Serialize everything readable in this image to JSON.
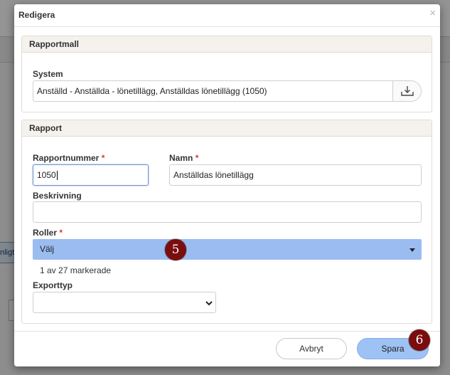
{
  "background": {
    "chip_text": "nligt"
  },
  "modal": {
    "title": "Redigera",
    "close_glyph": "×"
  },
  "panel_rapportmall": {
    "heading": "Rapportmall",
    "system_label": "System",
    "system_value": "Anställd - Anställda - lönetillägg, Anställdas lönetillägg (1050)",
    "download_icon": "download-tray-icon"
  },
  "panel_rapport": {
    "heading": "Rapport",
    "rapportnummer_label": "Rapportnummer",
    "rapportnummer_value": "1050",
    "namn_label": "Namn",
    "namn_value": "Anställdas lönetillägg",
    "required_mark": "*",
    "beskrivning_label": "Beskrivning",
    "beskrivning_value": "",
    "roller_label": "Roller",
    "roller_value": "Välj",
    "roller_hint": "1 av 27 markerade",
    "exporttyp_label": "Exporttyp",
    "exporttyp_value": ""
  },
  "footer": {
    "cancel_label": "Avbryt",
    "save_label": "Spara"
  },
  "markers": {
    "m5": "5",
    "m6": "6"
  },
  "colors": {
    "roller_bg": "#9bbcf1",
    "save_bg": "#9ec2f4",
    "required": "#d23b3b",
    "marker": "#7a0d0d"
  }
}
